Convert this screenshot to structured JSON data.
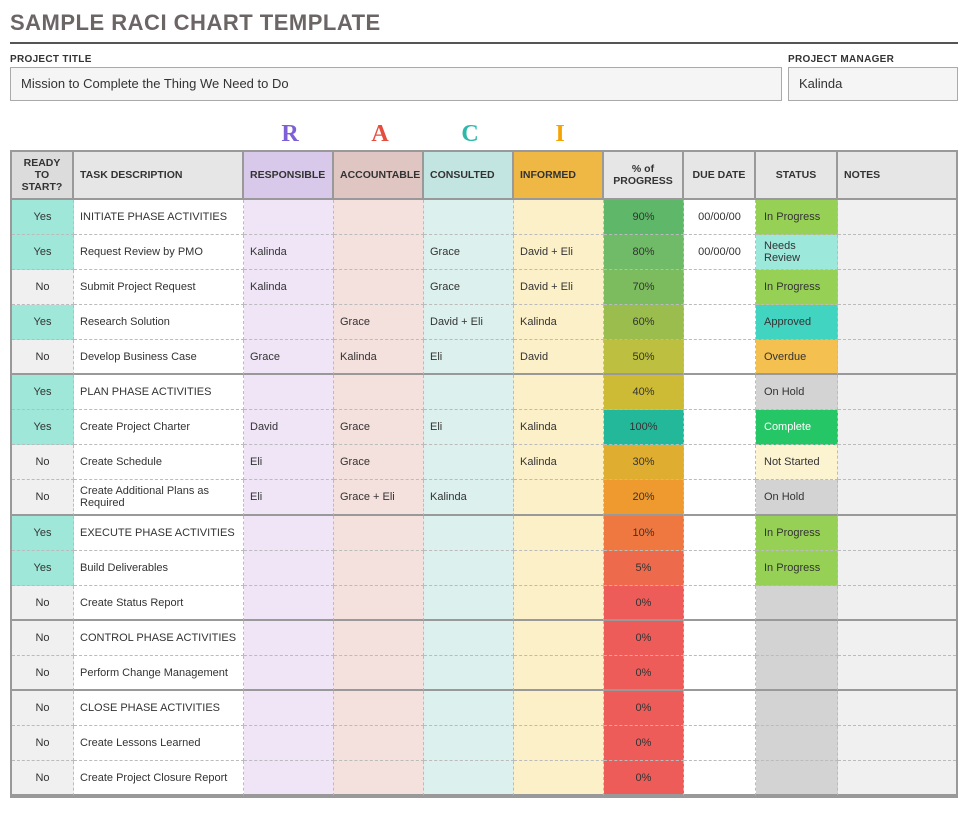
{
  "title": "SAMPLE RACI CHART TEMPLATE",
  "meta": {
    "projectTitleLabel": "PROJECT TITLE",
    "projectTitle": "Mission to Complete the Thing We Need to Do",
    "projectManagerLabel": "PROJECT MANAGER",
    "projectManager": "Kalinda"
  },
  "raci": {
    "r": "R",
    "a": "A",
    "c": "C",
    "i": "I"
  },
  "headers": {
    "ready": "READY TO START?",
    "task": "TASK DESCRIPTION",
    "responsible": "RESPONSIBLE",
    "accountable": "ACCOUNTABLE",
    "consulted": "CONSULTED",
    "informed": "INFORMED",
    "progress": "% of PROGRESS",
    "due": "DUE DATE",
    "status": "STATUS",
    "notes": "NOTES"
  },
  "sections": [
    {
      "rows": [
        {
          "ready": "Yes",
          "task": "INITIATE PHASE ACTIVITIES",
          "responsible": "",
          "accountable": "",
          "consulted": "",
          "informed": "",
          "progress": "90%",
          "pclass": "p90",
          "due": "00/00/00",
          "status": "In Progress",
          "sclass": "st-inprogress",
          "notes": ""
        },
        {
          "ready": "Yes",
          "task": "Request Review by PMO",
          "responsible": "Kalinda",
          "accountable": "",
          "consulted": "Grace",
          "informed": "David + Eli",
          "progress": "80%",
          "pclass": "p80",
          "due": "00/00/00",
          "status": "Needs Review",
          "sclass": "st-needsreview",
          "notes": ""
        },
        {
          "ready": "No",
          "task": "Submit Project Request",
          "responsible": "Kalinda",
          "accountable": "",
          "consulted": "Grace",
          "informed": "David + Eli",
          "progress": "70%",
          "pclass": "p70",
          "due": "",
          "status": "In Progress",
          "sclass": "st-inprogress",
          "notes": ""
        },
        {
          "ready": "Yes",
          "task": "Research Solution",
          "responsible": "",
          "accountable": "Grace",
          "consulted": "David + Eli",
          "informed": "Kalinda",
          "progress": "60%",
          "pclass": "p60",
          "due": "",
          "status": "Approved",
          "sclass": "st-approved",
          "notes": ""
        },
        {
          "ready": "No",
          "task": "Develop Business Case",
          "responsible": "Grace",
          "accountable": "Kalinda",
          "consulted": "Eli",
          "informed": "David",
          "progress": "50%",
          "pclass": "p50",
          "due": "",
          "status": "Overdue",
          "sclass": "st-overdue",
          "notes": ""
        }
      ]
    },
    {
      "rows": [
        {
          "ready": "Yes",
          "task": "PLAN PHASE ACTIVITIES",
          "responsible": "",
          "accountable": "",
          "consulted": "",
          "informed": "",
          "progress": "40%",
          "pclass": "p40",
          "due": "",
          "status": "On Hold",
          "sclass": "st-onhold",
          "notes": ""
        },
        {
          "ready": "Yes",
          "task": "Create Project Charter",
          "responsible": "David",
          "accountable": "Grace",
          "consulted": "Eli",
          "informed": "Kalinda",
          "progress": "100%",
          "pclass": "p100",
          "due": "",
          "status": "Complete",
          "sclass": "st-complete",
          "notes": ""
        },
        {
          "ready": "No",
          "task": "Create Schedule",
          "responsible": "Eli",
          "accountable": "Grace",
          "consulted": "",
          "informed": "Kalinda",
          "progress": "30%",
          "pclass": "p30",
          "due": "",
          "status": "Not Started",
          "sclass": "st-notstarted",
          "notes": ""
        },
        {
          "ready": "No",
          "task": "Create Additional Plans as Required",
          "responsible": "Eli",
          "accountable": "Grace + Eli",
          "consulted": "Kalinda",
          "informed": "",
          "progress": "20%",
          "pclass": "p20",
          "due": "",
          "status": "On Hold",
          "sclass": "st-onhold",
          "notes": ""
        }
      ]
    },
    {
      "rows": [
        {
          "ready": "Yes",
          "task": "EXECUTE PHASE ACTIVITIES",
          "responsible": "",
          "accountable": "",
          "consulted": "",
          "informed": "",
          "progress": "10%",
          "pclass": "p10",
          "due": "",
          "status": "In Progress",
          "sclass": "st-inprogress",
          "notes": ""
        },
        {
          "ready": "Yes",
          "task": "Build Deliverables",
          "responsible": "",
          "accountable": "",
          "consulted": "",
          "informed": "",
          "progress": "5%",
          "pclass": "p5",
          "due": "",
          "status": "In Progress",
          "sclass": "st-inprogress",
          "notes": ""
        },
        {
          "ready": "No",
          "task": "Create Status Report",
          "responsible": "",
          "accountable": "",
          "consulted": "",
          "informed": "",
          "progress": "0%",
          "pclass": "p0",
          "due": "",
          "status": "",
          "sclass": "st-blank",
          "notes": ""
        }
      ]
    },
    {
      "rows": [
        {
          "ready": "No",
          "task": "CONTROL PHASE ACTIVITIES",
          "responsible": "",
          "accountable": "",
          "consulted": "",
          "informed": "",
          "progress": "0%",
          "pclass": "p0",
          "due": "",
          "status": "",
          "sclass": "st-blank",
          "notes": ""
        },
        {
          "ready": "No",
          "task": "Perform Change Management",
          "responsible": "",
          "accountable": "",
          "consulted": "",
          "informed": "",
          "progress": "0%",
          "pclass": "p0",
          "due": "",
          "status": "",
          "sclass": "st-blank",
          "notes": ""
        }
      ]
    },
    {
      "rows": [
        {
          "ready": "No",
          "task": "CLOSE PHASE ACTIVITIES",
          "responsible": "",
          "accountable": "",
          "consulted": "",
          "informed": "",
          "progress": "0%",
          "pclass": "p0",
          "due": "",
          "status": "",
          "sclass": "st-blank",
          "notes": ""
        },
        {
          "ready": "No",
          "task": "Create Lessons Learned",
          "responsible": "",
          "accountable": "",
          "consulted": "",
          "informed": "",
          "progress": "0%",
          "pclass": "p0",
          "due": "",
          "status": "",
          "sclass": "st-blank",
          "notes": ""
        },
        {
          "ready": "No",
          "task": "Create Project Closure Report",
          "responsible": "",
          "accountable": "",
          "consulted": "",
          "informed": "",
          "progress": "0%",
          "pclass": "p0",
          "due": "",
          "status": "",
          "sclass": "st-blank",
          "notes": ""
        }
      ]
    }
  ]
}
